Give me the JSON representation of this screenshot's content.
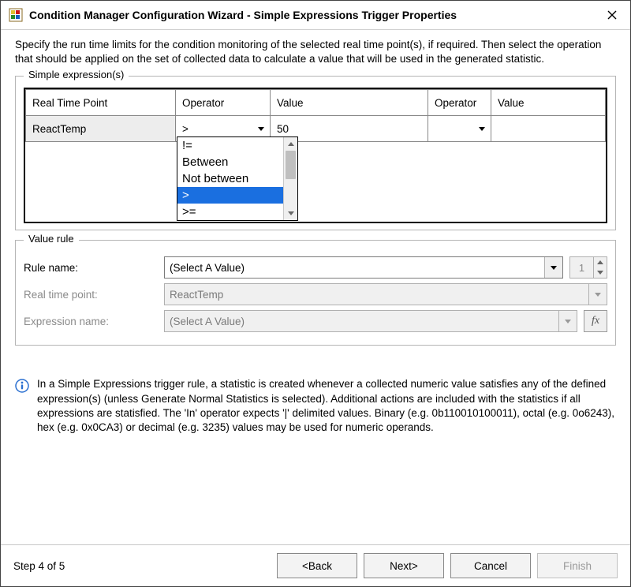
{
  "window": {
    "title": "Condition Manager Configuration Wizard - Simple Expressions Trigger Properties"
  },
  "intro": "Specify the run time limits for the condition monitoring of the selected real time point(s), if required. Then select the operation that should be applied on the set of collected data to calculate a value that will be used in the generated statistic.",
  "expressions": {
    "legend": "Simple expression(s)",
    "columns": [
      "Real Time Point",
      "Operator",
      "Value",
      "Operator",
      "Value"
    ],
    "rows": [
      {
        "point": "ReactTemp",
        "op1": ">",
        "val1": "50",
        "op2": "",
        "val2": ""
      }
    ],
    "operator_dropdown": {
      "options": [
        "!=",
        "Between",
        "Not between",
        ">",
        ">="
      ],
      "selected_index": 3
    }
  },
  "value_rule": {
    "legend": "Value rule",
    "rule_name_label": "Rule name:",
    "rule_name_value": "(Select A Value)",
    "spinner_value": "1",
    "rtp_label": "Real time point:",
    "rtp_value": "ReactTemp",
    "expr_label": "Expression name:",
    "expr_value": "(Select A Value)",
    "fx_label": "fx"
  },
  "info": {
    "text": "In a Simple Expressions trigger rule, a statistic is created whenever a collected numeric value satisfies any of the defined expression(s) (unless Generate Normal Statistics is selected). Additional actions are included with the statistics if all expressions are statisfied. The 'In' operator expects '|' delimited values. Binary (e.g. 0b110010100011), octal (e.g. 0o6243), hex (e.g. 0x0CA3) or decimal (e.g. 3235) values may be used for numeric operands."
  },
  "footer": {
    "step": "Step 4 of 5",
    "back": "<Back",
    "next": "Next>",
    "cancel": "Cancel",
    "finish": "Finish"
  }
}
